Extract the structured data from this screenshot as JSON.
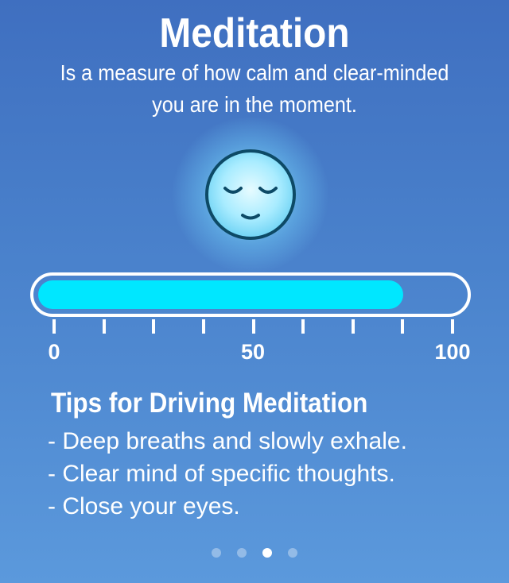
{
  "header": {
    "title": "Meditation",
    "subtitle": "Is a measure of how calm and clear-minded you are in the moment."
  },
  "face_icon": "calm-face-icon",
  "meter": {
    "value": 86,
    "min": 0,
    "max": 100,
    "labels": {
      "min": "0",
      "mid": "50",
      "max": "100"
    },
    "fill_color": "#00e7ff"
  },
  "tips": {
    "title": "Tips for Driving Meditation",
    "items": [
      "- Deep breaths and slowly exhale.",
      "- Clear mind of specific thoughts.",
      "- Close your eyes."
    ]
  },
  "pager": {
    "total": 4,
    "active": 3
  },
  "colors": {
    "background_top": "#3f6fc0",
    "background_bottom": "#5b99dc"
  }
}
